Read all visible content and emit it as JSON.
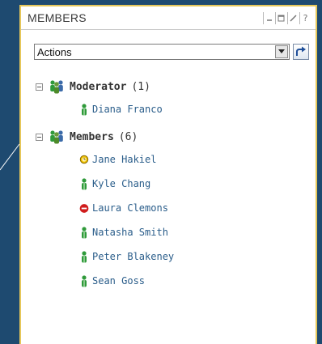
{
  "panel": {
    "title": "MEMBERS",
    "controls": {
      "minimize": "-",
      "maximize": "□",
      "edit": "/",
      "help": "?"
    }
  },
  "actions": {
    "selected": "Actions",
    "go_icon": "go-arrow-icon"
  },
  "groups": [
    {
      "name": "Moderator",
      "count": "(1)",
      "members": [
        {
          "name": "Diana Franco",
          "status": "online"
        }
      ]
    },
    {
      "name": "Members",
      "count": "(6)",
      "members": [
        {
          "name": "Jane Hakiel",
          "status": "away"
        },
        {
          "name": "Kyle Chang",
          "status": "online"
        },
        {
          "name": "Laura Clemons",
          "status": "busy"
        },
        {
          "name": "Natasha Smith",
          "status": "online"
        },
        {
          "name": "Peter Blakeney",
          "status": "online"
        },
        {
          "name": "Sean Goss",
          "status": "online"
        }
      ]
    }
  ],
  "colors": {
    "background": "#1e4a70",
    "panel_border": "#e6c75a",
    "member_link": "#2a5d8a",
    "online": "#2f9a3a",
    "away": "#e0b000",
    "busy": "#d01c1c"
  }
}
